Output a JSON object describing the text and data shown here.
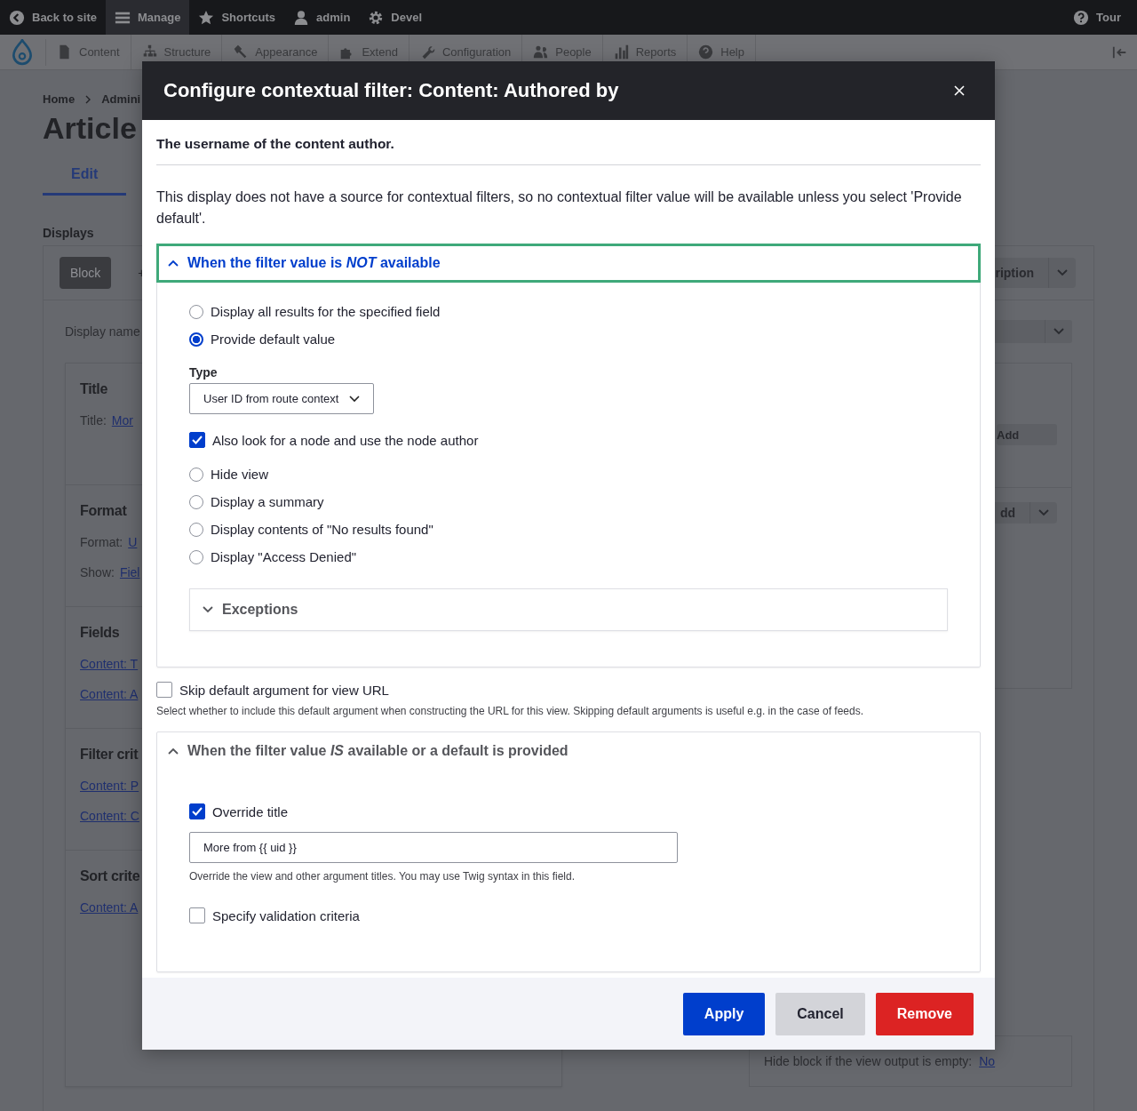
{
  "toolbar": {
    "items": [
      {
        "label": "Back to site",
        "selected": false
      },
      {
        "label": "Manage",
        "selected": true
      },
      {
        "label": "Shortcuts",
        "selected": false
      },
      {
        "label": "admin",
        "selected": false
      },
      {
        "label": "Devel",
        "selected": false
      }
    ],
    "tour": "Tour"
  },
  "admin_menu": {
    "items": [
      "Content",
      "Structure",
      "Appearance",
      "Extend",
      "Configuration",
      "People",
      "Reports",
      "Help"
    ]
  },
  "page": {
    "breadcrumb": [
      "Home",
      "Admini"
    ],
    "title": "Article",
    "tabs": [
      {
        "label": "Edit",
        "selected": true
      }
    ],
    "displays_label": "Displays",
    "display_tabs": [
      {
        "label": "Block",
        "selected": true
      },
      {
        "label": "+",
        "selected": false
      }
    ],
    "display_menu_button": "ription",
    "display_name_label": "Display name",
    "sections": [
      {
        "title": "Title",
        "rows": [
          {
            "label": "Title:",
            "link": "Mor"
          }
        ]
      },
      {
        "title": "Format",
        "rows": [
          {
            "label": "Format:",
            "link": "U"
          },
          {
            "label": "Show:",
            "link": "Fiel"
          }
        ]
      },
      {
        "title": "Fields",
        "rows": [
          {
            "link": "Content: T"
          },
          {
            "link": "Content: A"
          }
        ]
      },
      {
        "title": "Filter crit",
        "rows": [
          {
            "link": "Content: P"
          },
          {
            "link": "Content: C"
          }
        ]
      },
      {
        "title": "Sort crite",
        "rows": [
          {
            "link": "Content: A"
          }
        ]
      }
    ],
    "add_button": "Add",
    "add_split_button": "dd",
    "hide_block_label": "Hide block if the view output is empty:",
    "hide_block_value": "No"
  },
  "dialog": {
    "title": "Configure contextual filter: Content: Authored by",
    "description": "The username of the content author.",
    "notice": "This display does not have a source for contextual filters, so no contextual filter value will be available unless you select 'Provide default'.",
    "groups": [
      {
        "title": "When the filter value is *NOT* available",
        "expanded": true,
        "focused": true,
        "options": [
          {
            "kind": "radio",
            "label": "Display all results for the specified field",
            "selected": false
          },
          {
            "kind": "radio",
            "label": "Provide default value",
            "selected": true
          },
          {
            "kind": "select",
            "label": "Type",
            "value": "User ID from route context"
          },
          {
            "kind": "checkbox",
            "label": "Also look for a node and use the node author",
            "checked": true
          },
          {
            "kind": "radio",
            "label": "Hide view",
            "selected": false
          },
          {
            "kind": "radio",
            "label": "Display a summary",
            "selected": false
          },
          {
            "kind": "radio",
            "label": "Display contents of \"No results found\"",
            "selected": false
          },
          {
            "kind": "radio",
            "label": "Display \"Access Denied\"",
            "selected": false
          },
          {
            "kind": "details",
            "label": "Exceptions",
            "expanded": false
          }
        ]
      },
      {
        "kind": "checkbox",
        "label": "Skip default argument for view URL",
        "checked": false,
        "description": "Select whether to include this default argument when constructing the URL for this view. Skipping default arguments is useful e.g. in the case of feeds."
      },
      {
        "title": "When the filter value *IS* available or a default is provided",
        "expanded": true,
        "focused": false,
        "options": [
          {
            "kind": "checkbox",
            "label": "Override title",
            "checked": true
          },
          {
            "kind": "input",
            "value": "More from {{ uid }}",
            "description": "Override the view and other argument titles. You may use Twig syntax in this field."
          },
          {
            "kind": "checkbox",
            "label": "Specify validation criteria",
            "checked": false
          }
        ]
      }
    ],
    "buttons": [
      {
        "label": "Apply",
        "kind": "primary"
      },
      {
        "label": "Cancel",
        "kind": "secondary"
      },
      {
        "label": "Remove",
        "kind": "danger"
      }
    ]
  }
}
